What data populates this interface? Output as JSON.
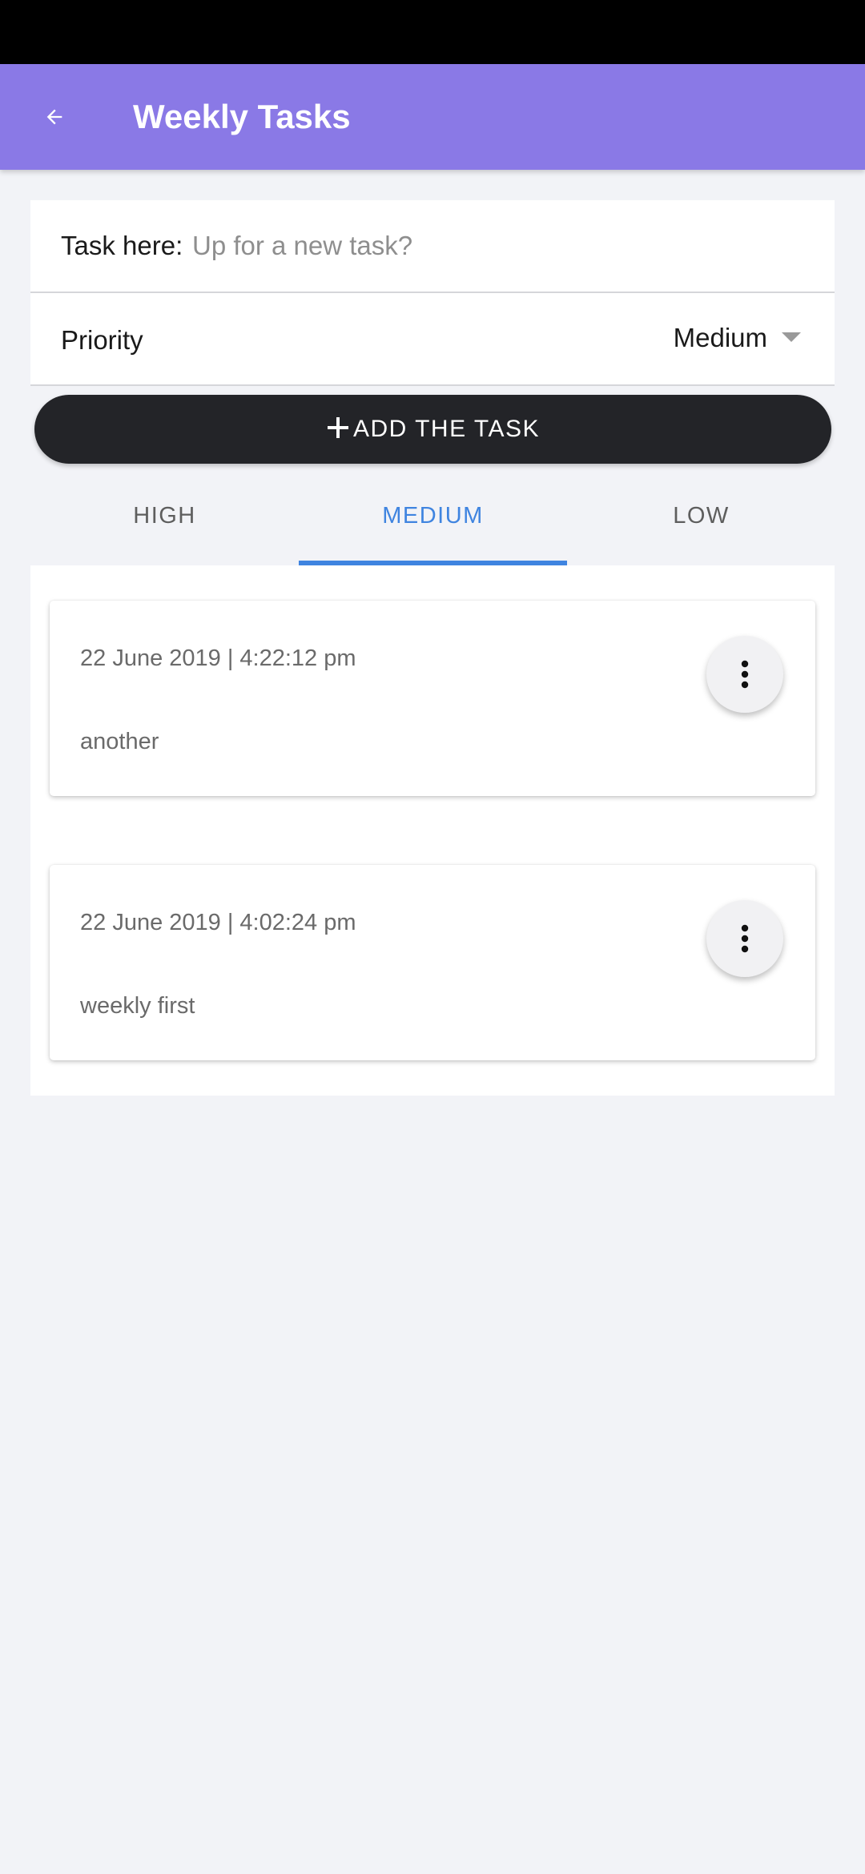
{
  "app_bar": {
    "back_icon": "arrow-left-icon",
    "title": "Weekly Tasks",
    "color": "#8a79e6"
  },
  "form": {
    "task_label": "Task here:",
    "task_placeholder": "Up for a new task?",
    "task_value": "",
    "priority_label": "Priority",
    "priority_value": "Medium",
    "priority_icon": "caret-down-icon"
  },
  "add_button": {
    "icon": "plus-icon",
    "label": "ADD THE TASK"
  },
  "tabs": [
    {
      "label": "HIGH",
      "active": false
    },
    {
      "label": "MEDIUM",
      "active": true
    },
    {
      "label": "LOW",
      "active": false
    }
  ],
  "accent_color": "#3f84e0",
  "tasks": [
    {
      "date": "22 June 2019 | 4:22:12 pm",
      "text": "another",
      "menu_icon": "more-vertical-icon"
    },
    {
      "date": "22 June 2019 | 4:02:24 pm",
      "text": "weekly first",
      "menu_icon": "more-vertical-icon"
    }
  ]
}
